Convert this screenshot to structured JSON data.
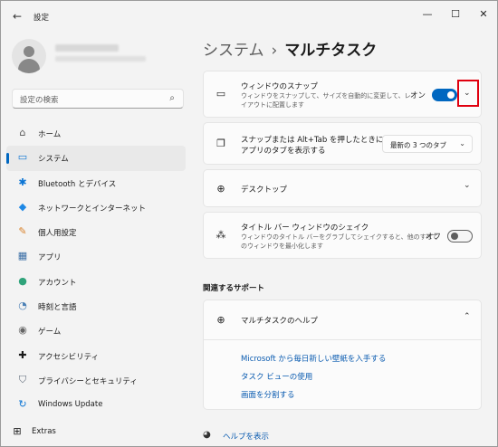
{
  "window": {
    "title": "設定"
  },
  "sidebar": {
    "search_placeholder": "設定の検索",
    "items": [
      {
        "label": "ホーム",
        "icon": "home-icon"
      },
      {
        "label": "システム",
        "icon": "system-icon",
        "active": true
      },
      {
        "label": "Bluetooth とデバイス",
        "icon": "bluetooth-icon"
      },
      {
        "label": "ネットワークとインターネット",
        "icon": "network-icon"
      },
      {
        "label": "個人用設定",
        "icon": "brush-icon"
      },
      {
        "label": "アプリ",
        "icon": "apps-icon"
      },
      {
        "label": "アカウント",
        "icon": "account-icon"
      },
      {
        "label": "時刻と言語",
        "icon": "globe-clock-icon"
      },
      {
        "label": "ゲーム",
        "icon": "gamepad-icon"
      },
      {
        "label": "アクセシビリティ",
        "icon": "accessibility-icon"
      },
      {
        "label": "プライバシーとセキュリティ",
        "icon": "shield-icon"
      },
      {
        "label": "Windows Update",
        "icon": "update-icon"
      }
    ],
    "extras_label": "Extras"
  },
  "breadcrumb": {
    "parent": "システム",
    "separator": "›",
    "current": "マルチタスク"
  },
  "snap": {
    "title": "ウィンドウのスナップ",
    "desc_line1": "ウィンドウをスナップして、サイズを自動的に変更して、レ",
    "desc_line2": "イアウトに配置します",
    "toggle_label": "オン",
    "toggle_on": true
  },
  "alttab": {
    "title_line1": "スナップまたは Alt+Tab を押したときに",
    "title_line2": "アプリのタブを表示する",
    "dropdown_value": "最新の 3 つのタブ"
  },
  "desktops": {
    "title": "デスクトップ"
  },
  "shake": {
    "title": "タイトル バー ウィンドウのシェイク",
    "desc_line1": "ウィンドウのタイトル バーをグラブしてシェイクすると、他のすべて",
    "desc_line2": "のウィンドウを最小化します",
    "toggle_label": "オフ",
    "toggle_on": false
  },
  "support": {
    "section_title": "関連するサポート",
    "help_title": "マルチタスクのヘルプ",
    "links": [
      "Microsoft から毎日新しい壁紙を入手する",
      "タスク ビューの使用",
      "画面を分割する"
    ]
  },
  "footer": {
    "help_label": "ヘルプを表示"
  },
  "colors": {
    "accent": "#0067c0",
    "highlight": "#e0000f",
    "link": "#0a5bb0"
  }
}
